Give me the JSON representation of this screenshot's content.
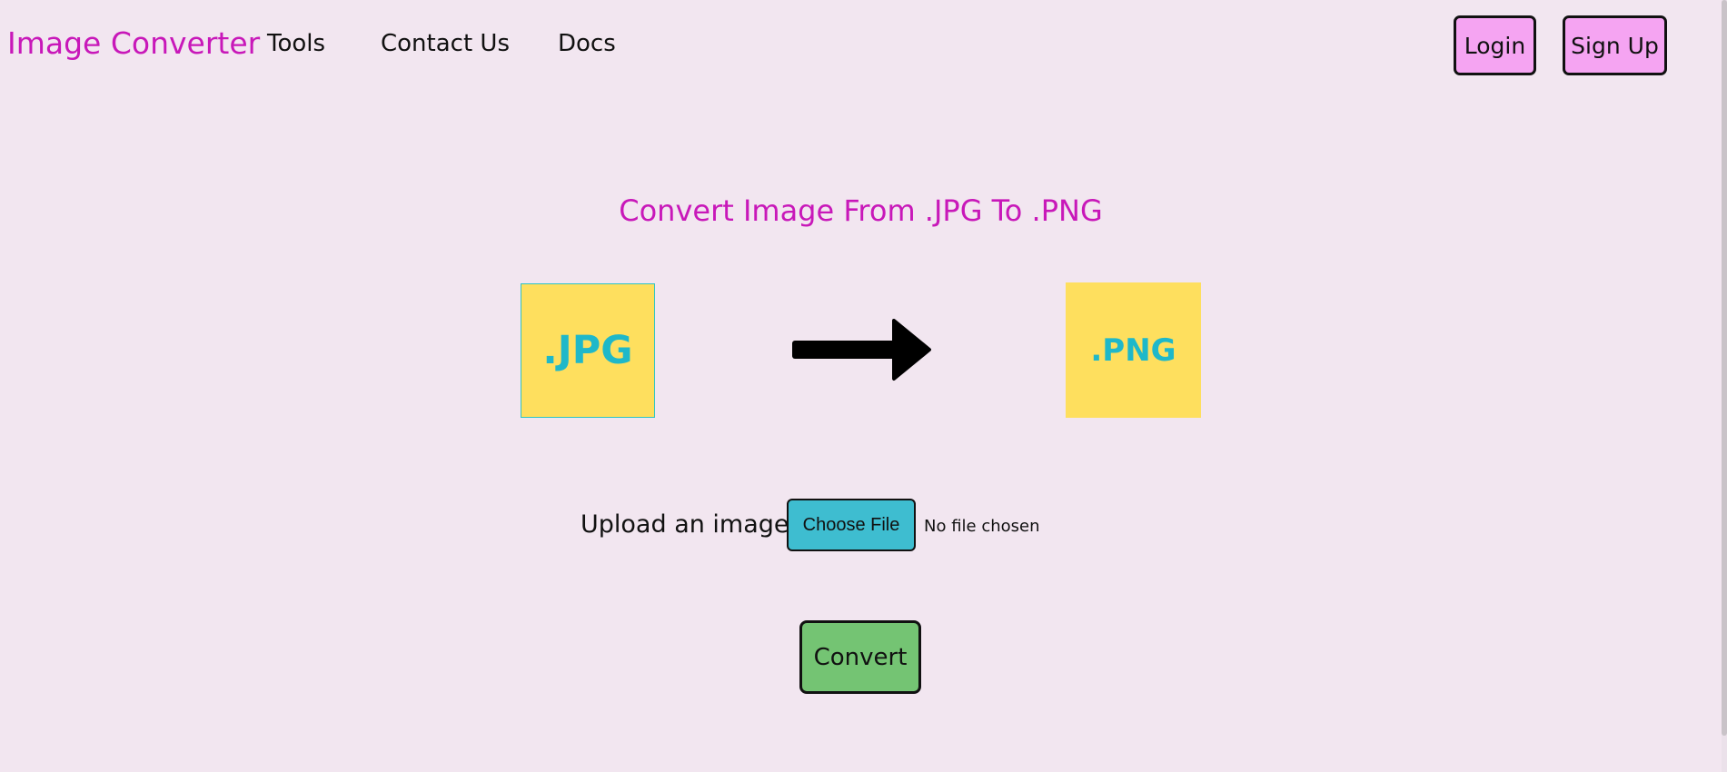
{
  "navbar": {
    "brand": "Image Converter",
    "links": [
      "Tools",
      "Contact Us",
      "Docs"
    ],
    "login_label": "Login",
    "signup_label": "Sign Up"
  },
  "main": {
    "heading": "Convert Image From .JPG To .PNG",
    "source_format": ".JPG",
    "target_format": ".PNG",
    "upload_label": "Upload an image",
    "choose_file_label": "Choose File",
    "file_status": "No file chosen",
    "convert_label": "Convert"
  },
  "colors": {
    "background": "#f2e6f0",
    "brand": "#c818b9",
    "auth_button": "#f5a4f2",
    "format_box": "#fedf5e",
    "format_text": "#1fb8c9",
    "choose_button": "#3ebdd0",
    "convert_button": "#74c473"
  },
  "icons": {
    "direction": "arrow-right-icon"
  }
}
